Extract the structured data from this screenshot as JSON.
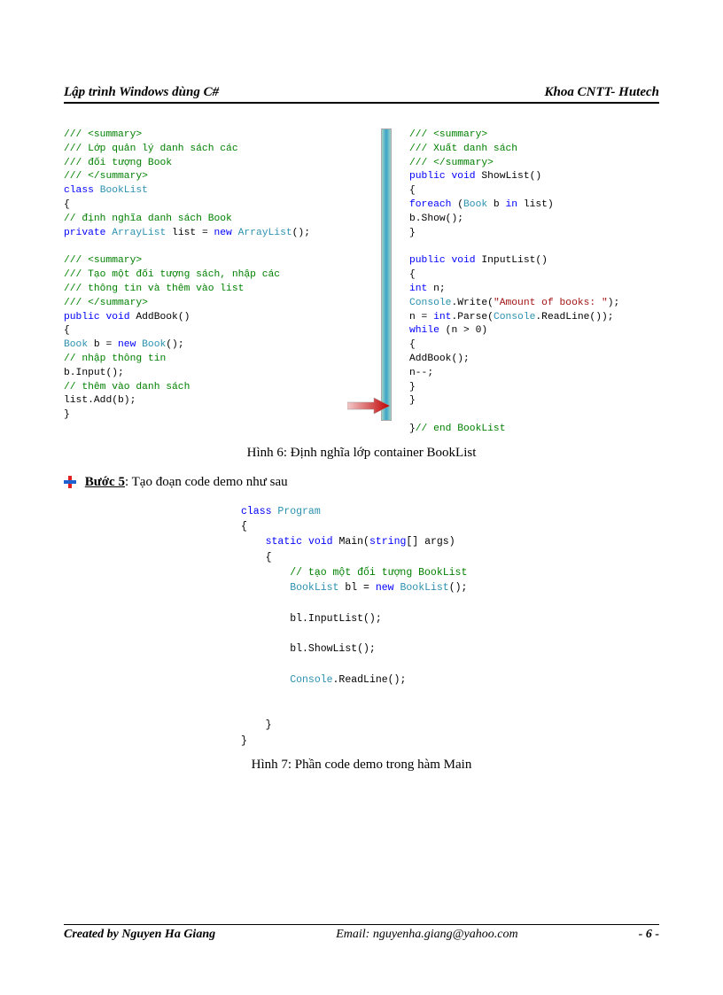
{
  "header": {
    "left": "Lập trình Windows dùng C#",
    "right": "Khoa CNTT- Hutech"
  },
  "code_left": [
    {
      "cls": "cmt",
      "txt": "/// <summary>",
      "ind": 0
    },
    {
      "cls": "cmt",
      "txt": "/// Lớp quản lý danh sách các",
      "ind": 0
    },
    {
      "cls": "cmt",
      "txt": "/// đối tượng Book",
      "ind": 0
    },
    {
      "cls": "cmt",
      "txt": "/// </summary>",
      "ind": 0
    },
    {
      "mix": [
        {
          "cls": "kw",
          "txt": "class"
        },
        {
          "txt": " "
        },
        {
          "cls": "typ",
          "txt": "BookList"
        }
      ],
      "ind": 0
    },
    {
      "txt": "{",
      "ind": 0
    },
    {
      "cls": "cmt",
      "txt": "// định nghĩa danh sách Book",
      "ind": 1
    },
    {
      "mix": [
        {
          "cls": "kw",
          "txt": "private"
        },
        {
          "txt": " "
        },
        {
          "cls": "typ",
          "txt": "ArrayList"
        },
        {
          "txt": " list = "
        },
        {
          "cls": "kw",
          "txt": "new"
        },
        {
          "txt": " "
        },
        {
          "cls": "typ",
          "txt": "ArrayList"
        },
        {
          "txt": "();"
        }
      ],
      "ind": 1
    },
    {
      "txt": "",
      "ind": 0
    },
    {
      "cls": "cmt",
      "txt": "/// <summary>",
      "ind": 1
    },
    {
      "cls": "cmt",
      "txt": "/// Tạo một đối tượng sách, nhập các",
      "ind": 1
    },
    {
      "cls": "cmt",
      "txt": "/// thông tin và thêm vào list",
      "ind": 1
    },
    {
      "cls": "cmt",
      "txt": "/// </summary>",
      "ind": 1
    },
    {
      "mix": [
        {
          "cls": "kw",
          "txt": "public"
        },
        {
          "txt": " "
        },
        {
          "cls": "kw",
          "txt": "void"
        },
        {
          "txt": " AddBook()"
        }
      ],
      "ind": 1
    },
    {
      "txt": "{",
      "ind": 1
    },
    {
      "mix": [
        {
          "cls": "typ",
          "txt": "Book"
        },
        {
          "txt": " b = "
        },
        {
          "cls": "kw",
          "txt": "new"
        },
        {
          "txt": " "
        },
        {
          "cls": "typ",
          "txt": "Book"
        },
        {
          "txt": "();"
        }
      ],
      "ind": 2
    },
    {
      "cls": "cmt",
      "txt": "// nhập thông tin",
      "ind": 2
    },
    {
      "txt": "b.Input();",
      "ind": 2
    },
    {
      "cls": "cmt",
      "txt": "// thêm vào danh sách",
      "ind": 2
    },
    {
      "txt": "list.Add(b);",
      "ind": 2
    },
    {
      "txt": "}",
      "ind": 1
    }
  ],
  "code_right": [
    {
      "cls": "cmt",
      "txt": "/// <summary>",
      "ind": 1
    },
    {
      "cls": "cmt",
      "txt": "/// Xuất danh sách",
      "ind": 1
    },
    {
      "cls": "cmt",
      "txt": "/// </summary>",
      "ind": 1
    },
    {
      "mix": [
        {
          "cls": "kw",
          "txt": "public"
        },
        {
          "txt": " "
        },
        {
          "cls": "kw",
          "txt": "void"
        },
        {
          "txt": " ShowList()"
        }
      ],
      "ind": 1
    },
    {
      "txt": "{",
      "ind": 1
    },
    {
      "mix": [
        {
          "cls": "kw",
          "txt": "foreach"
        },
        {
          "txt": " ("
        },
        {
          "cls": "typ",
          "txt": "Book"
        },
        {
          "txt": " b "
        },
        {
          "cls": "kw",
          "txt": "in"
        },
        {
          "txt": " list)"
        }
      ],
      "ind": 2
    },
    {
      "txt": "b.Show();",
      "ind": 3
    },
    {
      "txt": "}",
      "ind": 1
    },
    {
      "txt": "",
      "ind": 0
    },
    {
      "mix": [
        {
          "cls": "kw",
          "txt": "public"
        },
        {
          "txt": " "
        },
        {
          "cls": "kw",
          "txt": "void"
        },
        {
          "txt": " InputList()"
        }
      ],
      "ind": 1
    },
    {
      "txt": "{",
      "ind": 1
    },
    {
      "mix": [
        {
          "cls": "kw",
          "txt": "int"
        },
        {
          "txt": " n;"
        }
      ],
      "ind": 2
    },
    {
      "mix": [
        {
          "cls": "typ",
          "txt": "Console"
        },
        {
          "txt": ".Write("
        },
        {
          "cls": "str",
          "txt": "\"Amount of books: \""
        },
        {
          "txt": ");"
        }
      ],
      "ind": 2
    },
    {
      "mix": [
        {
          "txt": "n = "
        },
        {
          "cls": "kw",
          "txt": "int"
        },
        {
          "txt": ".Parse("
        },
        {
          "cls": "typ",
          "txt": "Console"
        },
        {
          "txt": ".ReadLine());"
        }
      ],
      "ind": 2
    },
    {
      "mix": [
        {
          "cls": "kw",
          "txt": "while"
        },
        {
          "txt": " (n > 0)"
        }
      ],
      "ind": 2
    },
    {
      "txt": "{",
      "ind": 2
    },
    {
      "txt": "AddBook();",
      "ind": 3
    },
    {
      "txt": "n--;",
      "ind": 3
    },
    {
      "txt": "}",
      "ind": 2
    },
    {
      "txt": "}",
      "ind": 1
    },
    {
      "txt": "",
      "ind": 0
    },
    {
      "mix": [
        {
          "txt": "}"
        },
        {
          "cls": "cmt",
          "txt": "// end BookList"
        }
      ],
      "ind": 0
    }
  ],
  "caption1": "Hình 6: Định nghĩa lớp container BookList",
  "step": {
    "label": "Bước 5",
    "rest": ":  Tạo đoạn code demo như sau"
  },
  "code_center": [
    {
      "mix": [
        {
          "cls": "kw",
          "txt": "class"
        },
        {
          "txt": " "
        },
        {
          "cls": "typ",
          "txt": "Program"
        }
      ],
      "ind": 0
    },
    {
      "txt": "{",
      "ind": 0
    },
    {
      "mix": [
        {
          "cls": "kw",
          "txt": "static"
        },
        {
          "txt": " "
        },
        {
          "cls": "kw",
          "txt": "void"
        },
        {
          "txt": " Main("
        },
        {
          "cls": "kw",
          "txt": "string"
        },
        {
          "txt": "[] args)"
        }
      ],
      "ind": 1
    },
    {
      "txt": "{",
      "ind": 1
    },
    {
      "cls": "cmt",
      "txt": "// tạo một đối tượng BookList",
      "ind": 2
    },
    {
      "mix": [
        {
          "cls": "typ",
          "txt": "BookList"
        },
        {
          "txt": " bl = "
        },
        {
          "cls": "kw",
          "txt": "new"
        },
        {
          "txt": " "
        },
        {
          "cls": "typ",
          "txt": "BookList"
        },
        {
          "txt": "();"
        }
      ],
      "ind": 2
    },
    {
      "txt": "",
      "ind": 0
    },
    {
      "txt": "bl.InputList();",
      "ind": 2
    },
    {
      "txt": "",
      "ind": 0
    },
    {
      "txt": "bl.ShowList();",
      "ind": 2
    },
    {
      "txt": "",
      "ind": 0
    },
    {
      "mix": [
        {
          "cls": "typ",
          "txt": "Console"
        },
        {
          "txt": ".ReadLine();"
        }
      ],
      "ind": 2
    },
    {
      "txt": "",
      "ind": 0
    },
    {
      "txt": "",
      "ind": 0
    },
    {
      "txt": "}",
      "ind": 1
    },
    {
      "txt": "}",
      "ind": 0
    }
  ],
  "caption2": "Hình 7: Phần code demo trong hàm Main",
  "footer": {
    "author": "Created by Nguyen Ha Giang",
    "email": "Email: nguyenha.giang@yahoo.com",
    "pagelabel": "- 6 -"
  }
}
